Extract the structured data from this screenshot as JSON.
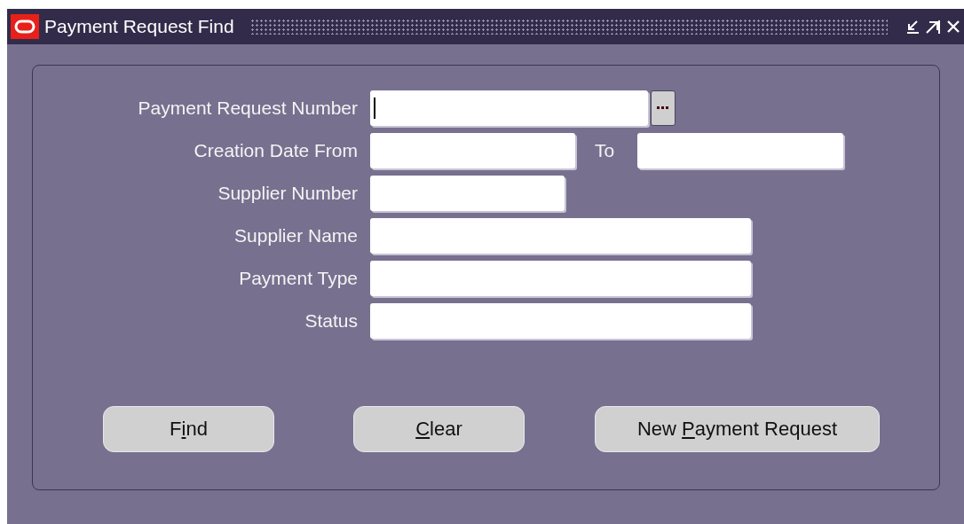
{
  "window": {
    "title": "Payment Request Find"
  },
  "fields": [
    {
      "label": "Payment Request Number",
      "kind": "lov",
      "focused": true
    },
    {
      "label": "Creation Date From",
      "kind": "range",
      "focused": false,
      "to_label": "To"
    },
    {
      "label": "Supplier Number",
      "kind": "text",
      "focused": false
    },
    {
      "label": "Supplier Name",
      "kind": "text",
      "focused": false
    },
    {
      "label": "Payment Type",
      "kind": "text",
      "focused": false
    },
    {
      "label": "Status",
      "kind": "text",
      "focused": false
    }
  ],
  "buttons": [
    {
      "label": "Find"
    },
    {
      "label": "Clear"
    },
    {
      "label": "New Payment Request"
    }
  ]
}
